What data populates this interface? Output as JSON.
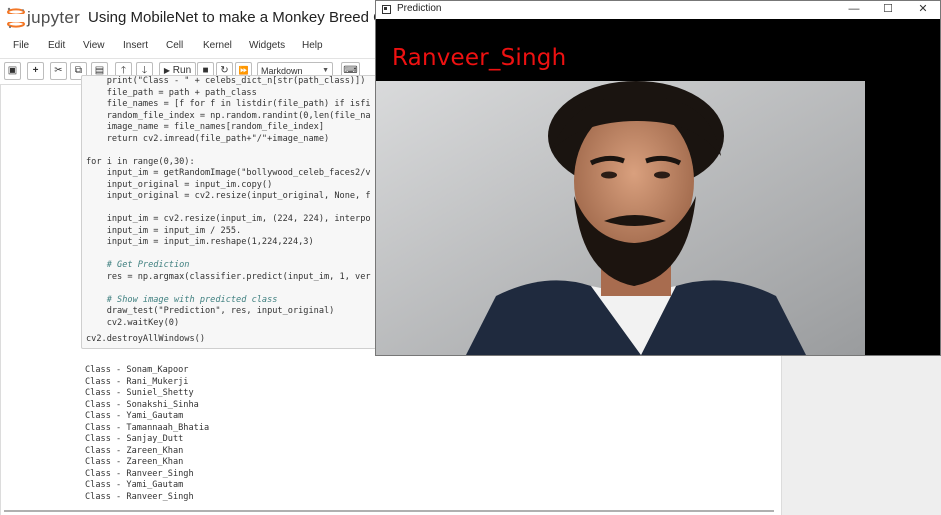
{
  "jupyter": {
    "logo_text": "jupyter",
    "notebook_title": "Using MobileNet to make a Monkey Breed Classi",
    "menu": [
      "File",
      "Edit",
      "View",
      "Insert",
      "Cell",
      "Kernel",
      "Widgets",
      "Help"
    ],
    "toolbar": {
      "run_label": "Run",
      "cell_type": "Markdown"
    },
    "code_lines": [
      "    print(\"Class - \" + celebs_dict_n[str(path_class)])",
      "    file_path = path + path_class",
      "    file_names = [f for f in listdir(file_path) if isfi",
      "    random_file_index = np.random.randint(0,len(file_na",
      "    image_name = file_names[random_file_index]",
      "    return cv2.imread(file_path+\"/\"+image_name)",
      "",
      "for i in range(0,30):",
      "    input_im = getRandomImage(\"bollywood_celeb_faces2/v",
      "    input_original = input_im.copy()",
      "    input_original = cv2.resize(input_original, None, f",
      "",
      "    input_im = cv2.resize(input_im, (224, 224), interpo",
      "    input_im = input_im / 255.",
      "    input_im = input_im.reshape(1,224,224,3)",
      "",
      "    # Get Prediction",
      "    res = np.argmax(classifier.predict(input_im, 1, ver",
      "",
      "    # Show image with predicted class",
      "    draw_test(\"Prediction\", res, input_original)",
      "    cv2.waitKey(0)",
      "",
      "cv2.destroyAllWindows()"
    ],
    "output_lines": [
      "Class - Sonam_Kapoor",
      "Class - Rani_Mukerji",
      "Class - Suniel_Shetty",
      "Class - Sonakshi_Sinha",
      "Class - Yami_Gautam",
      "Class - Tamannaah_Bhatia",
      "Class - Sanjay_Dutt",
      "Class - Zareen_Khan",
      "Class - Zareen_Khan",
      "Class - Ranveer_Singh",
      "Class - Yami_Gautam",
      "Class - Ranveer_Singh"
    ]
  },
  "prediction_window": {
    "title": "Prediction",
    "minimize": "—",
    "maximize": "☐",
    "close": "✕",
    "predicted_label": "Ranveer_Singh",
    "label_color": "#ee1111"
  }
}
